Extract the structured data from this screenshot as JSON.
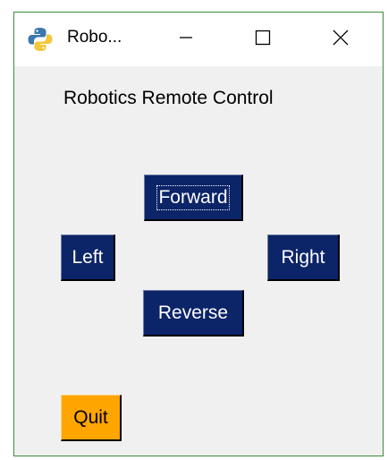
{
  "window": {
    "title": "Robo...",
    "app_icon": "python-icon",
    "controls": {
      "minimize_icon": "minimize-icon",
      "maximize_icon": "maximize-icon",
      "close_icon": "close-icon"
    }
  },
  "main": {
    "heading": "Robotics Remote Control",
    "buttons": {
      "forward": "Forward",
      "left": "Left",
      "right": "Right",
      "reverse": "Reverse",
      "quit": "Quit"
    }
  },
  "colors": {
    "control_button_bg": "#0c2468",
    "control_button_text": "#ffffff",
    "quit_button_bg": "#ffa500",
    "window_bg": "#f0f0f0",
    "window_border": "#3c8a3c"
  }
}
